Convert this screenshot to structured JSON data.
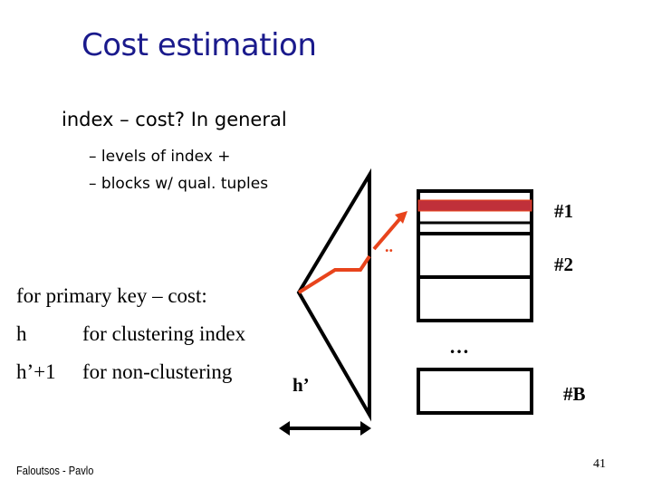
{
  "slide": {
    "title": "Cost estimation",
    "lead": "index – cost? In general",
    "bullets": [
      "–  levels of index +",
      "–  blocks w/ qual. tuples"
    ],
    "primary_key_heading": "for primary key – cost:",
    "cost_rows": [
      {
        "cost": "h",
        "description": "for clustering index"
      },
      {
        "cost": "h’+1",
        "description": "for non-clustering"
      }
    ],
    "footer": "Faloutsos - Pavlo",
    "page_number": "41"
  },
  "diagram": {
    "height_label": "h’",
    "block_labels": [
      "#1",
      "#2",
      "#B"
    ],
    "ellipsis": "…",
    "small_dots": "..",
    "colors": {
      "highlight_tuple": "#c0303a",
      "path": "#e8441c",
      "stroke": "#000000",
      "title": "#1a1a8c"
    }
  }
}
